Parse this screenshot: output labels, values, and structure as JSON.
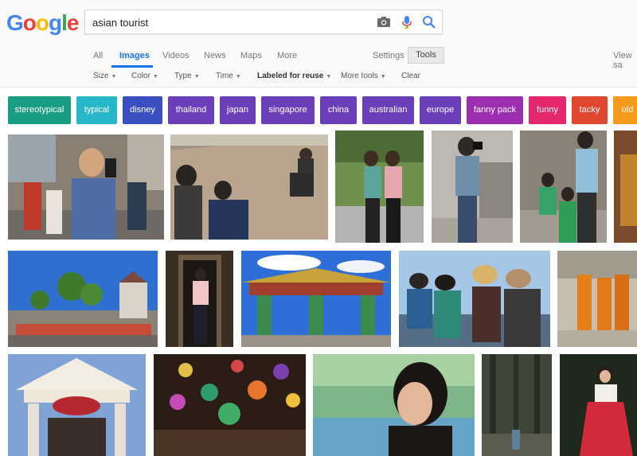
{
  "search": {
    "query": "asian tourist"
  },
  "logo": {
    "letters": [
      "G",
      "o",
      "o",
      "g",
      "l",
      "e"
    ],
    "colors": [
      "#4285F4",
      "#EA4335",
      "#FBBC05",
      "#4285F4",
      "#34A853",
      "#EA4335"
    ]
  },
  "tabs": {
    "all": "All",
    "images": "Images",
    "videos": "Videos",
    "news": "News",
    "maps": "Maps",
    "more": "More",
    "settings": "Settings",
    "tools": "Tools",
    "view_saved": "View sa"
  },
  "filters": {
    "size": "Size",
    "color": "Color",
    "type": "Type",
    "time": "Time",
    "labeled": "Labeled for reuse",
    "more_tools": "More tools",
    "clear": "Clear"
  },
  "chips": [
    {
      "label": "stereotypical",
      "color": "#1a9e83"
    },
    {
      "label": "typical",
      "color": "#27b7c9"
    },
    {
      "label": "disney",
      "color": "#3b4fc1"
    },
    {
      "label": "thailand",
      "color": "#6b3fb9"
    },
    {
      "label": "japan",
      "color": "#6b3fb9"
    },
    {
      "label": "singapore",
      "color": "#6b3fb9"
    },
    {
      "label": "china",
      "color": "#6b3fb9"
    },
    {
      "label": "australian",
      "color": "#6b3fb9"
    },
    {
      "label": "europe",
      "color": "#6b3fb9"
    },
    {
      "label": "fanny pack",
      "color": "#9c2fb0"
    },
    {
      "label": "funny",
      "color": "#e5286d"
    },
    {
      "label": "tacky",
      "color": "#e0472f"
    },
    {
      "label": "old",
      "color": "#f59a1c"
    }
  ],
  "colors": {
    "accent": "#1a73e8"
  }
}
